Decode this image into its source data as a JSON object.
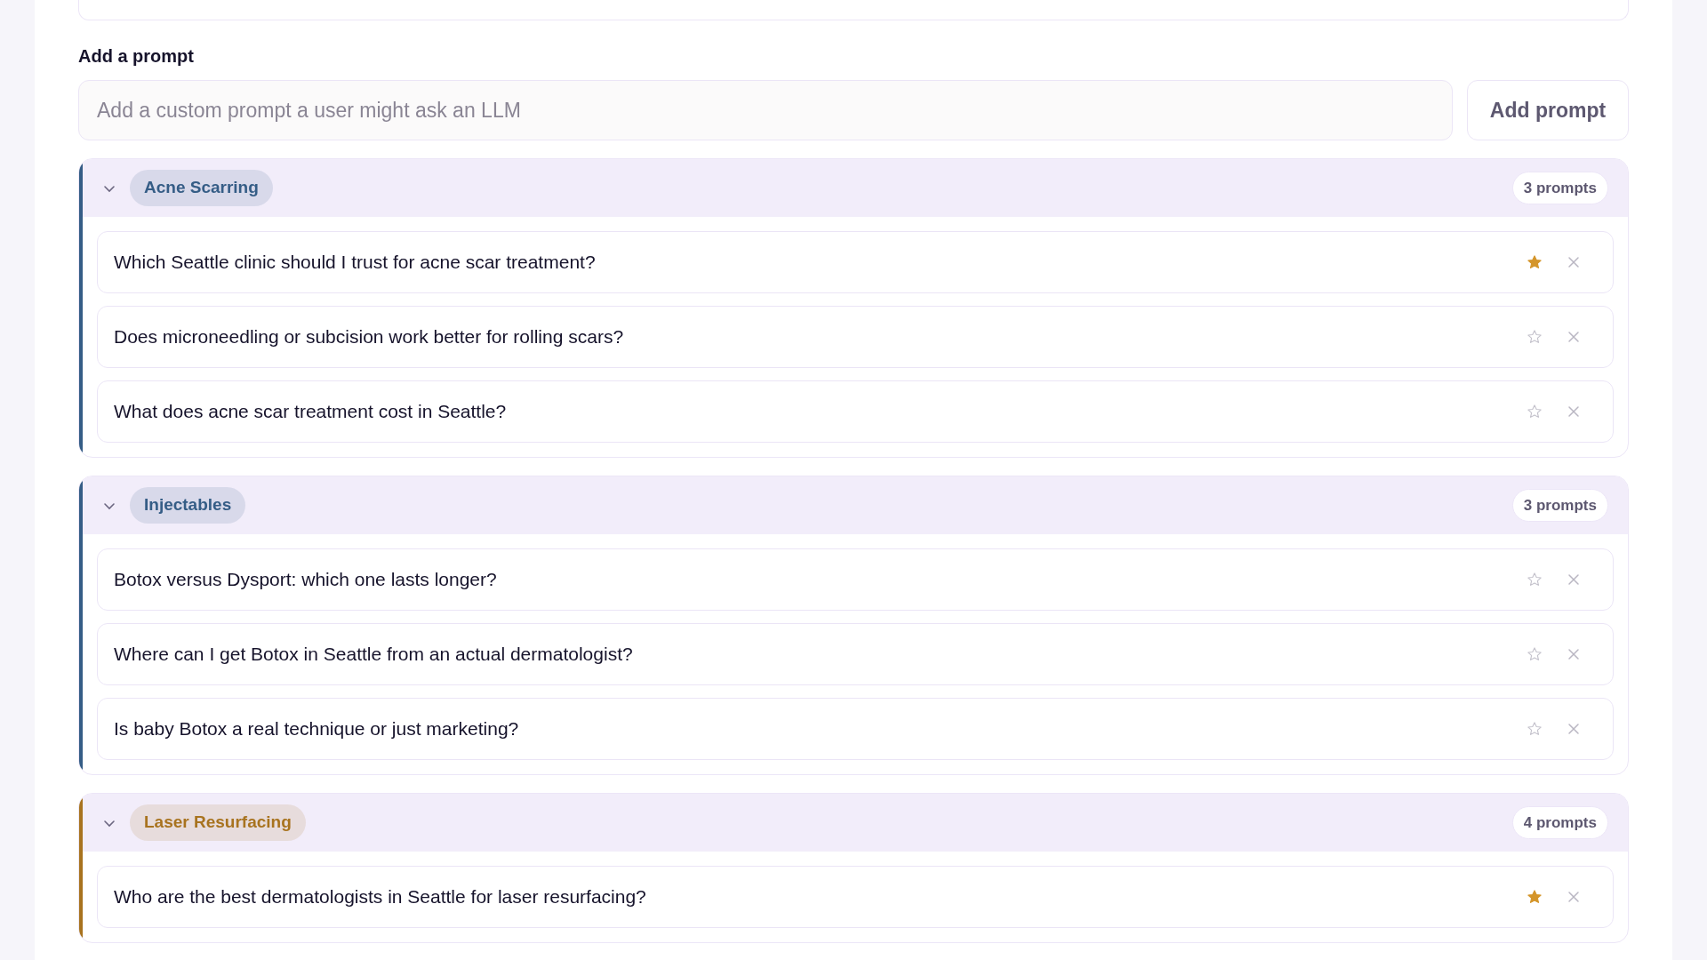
{
  "add_prompt": {
    "label": "Add a prompt",
    "placeholder": "Add a custom prompt a user might ask an LLM",
    "button": "Add prompt"
  },
  "groups": [
    {
      "name": "Acne Scarring",
      "color": "#355d86",
      "count": "3 prompts",
      "expanded": true,
      "prompts": [
        {
          "text": "Which Seattle clinic should I trust for acne scar treatment?",
          "starred": true
        },
        {
          "text": "Does microneedling or subcision work better for rolling scars?",
          "starred": false
        },
        {
          "text": "What does acne scar treatment cost in Seattle?",
          "starred": false
        }
      ]
    },
    {
      "name": "Injectables",
      "color": "#355d86",
      "count": "3 prompts",
      "expanded": true,
      "prompts": [
        {
          "text": "Botox versus Dysport: which one lasts longer?",
          "starred": false
        },
        {
          "text": "Where can I get Botox in Seattle from an actual dermatologist?",
          "starred": false
        },
        {
          "text": "Is baby Botox a real technique or just marketing?",
          "starred": false
        }
      ]
    },
    {
      "name": "Laser Resurfacing",
      "color": "#a8731f",
      "count": "4 prompts",
      "expanded": true,
      "prompts": [
        {
          "text": "Who are the best dermatologists in Seattle for laser resurfacing?",
          "starred": true
        }
      ]
    }
  ]
}
